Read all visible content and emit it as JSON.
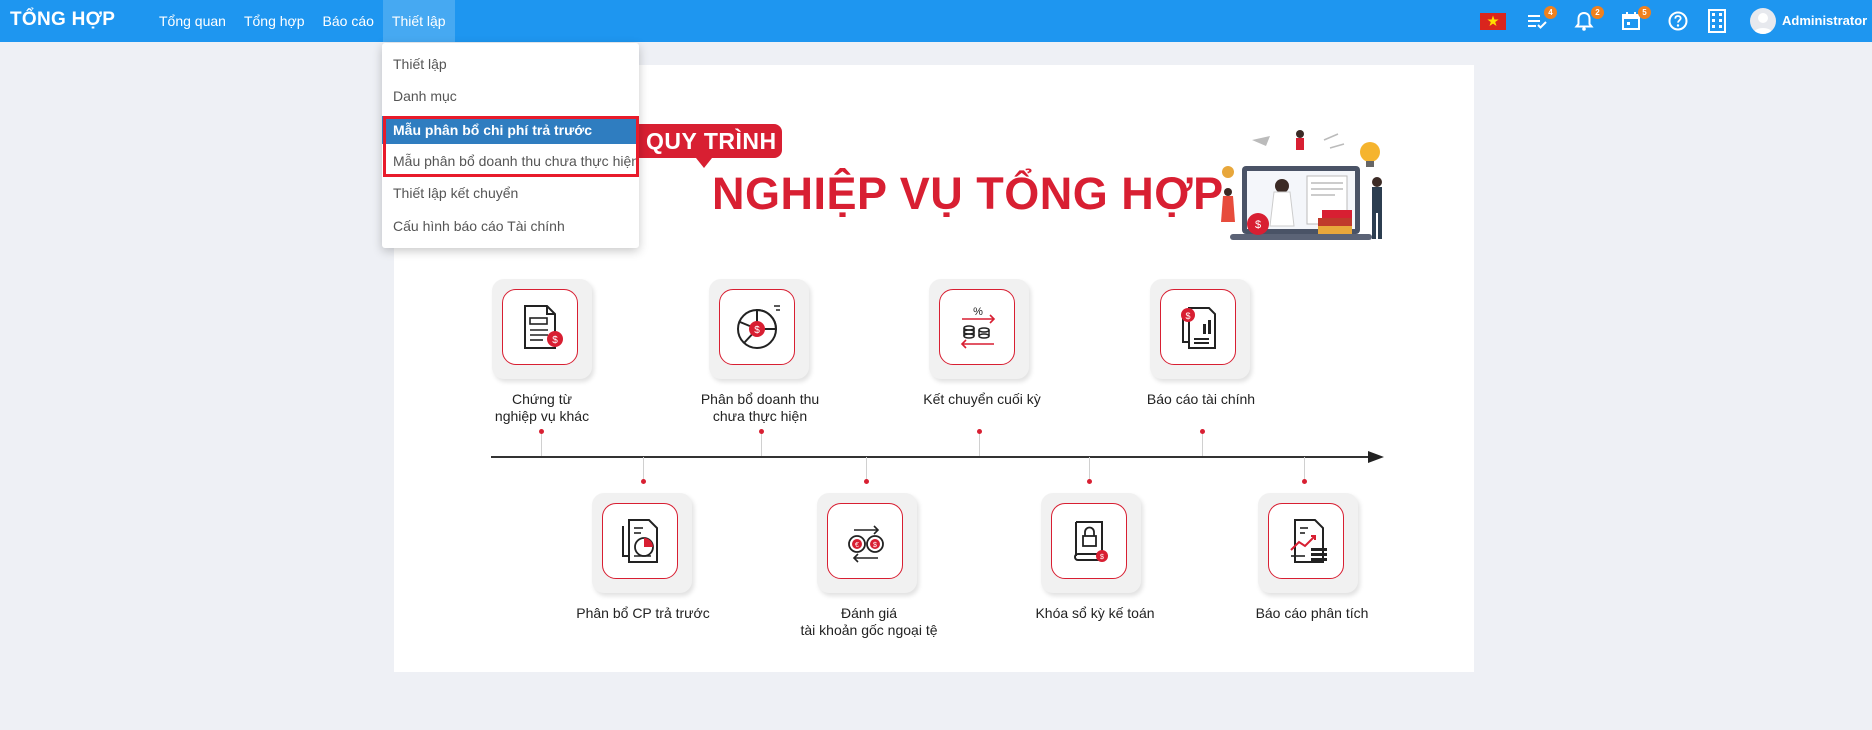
{
  "topbar": {
    "brand": "TỔNG HỢP",
    "nav": [
      "Tổng quan",
      "Tổng hợp",
      "Báo cáo",
      "Thiết lập"
    ],
    "active_nav": "Thiết lập",
    "badges": {
      "tasks": "4",
      "notifications": "2",
      "calendar": "5"
    },
    "user": "Administrator",
    "icons": [
      "vietnam-flag-icon",
      "task-list-icon",
      "bell-icon",
      "calendar-icon",
      "help-icon",
      "apps-grid-icon",
      "avatar"
    ]
  },
  "dropdown": {
    "items": [
      "Thiết lập",
      "Danh mục",
      "Mẫu phân bổ chi phí trả trước",
      "Mẫu phân bổ doanh thu chưa thực hiện",
      "Thiết lập kết chuyển",
      "Cấu hình báo cáo Tài chính"
    ],
    "selected": "Mẫu phân bổ chi phí trả trước"
  },
  "content": {
    "tag": "QUY TRÌNH",
    "title": "NGHIỆP VỤ TỔNG HỢP",
    "top_steps": [
      {
        "line1": "Chứng từ",
        "line2": "nghiệp vụ khác",
        "icon": "document-dollar-icon"
      },
      {
        "line1": "Phân bổ doanh thu",
        "line2": "chưa thực hiện",
        "icon": "pie-chart-dollar-icon"
      },
      {
        "line1": "Kết chuyển cuối kỳ",
        "line2": "",
        "icon": "transfer-coins-icon"
      },
      {
        "line1": "Báo cáo tài chính",
        "line2": "",
        "icon": "financial-report-icon"
      }
    ],
    "bottom_steps": [
      {
        "line1": "Phân bổ CP trả trước",
        "line2": "",
        "icon": "allocation-document-icon"
      },
      {
        "line1": "Đánh giá",
        "line2": "tài khoản gốc ngoại tệ",
        "icon": "currency-exchange-icon"
      },
      {
        "line1": "Khóa sổ kỳ kế toán",
        "line2": "",
        "icon": "lock-book-icon"
      },
      {
        "line1": "Báo cáo phân tích",
        "line2": "",
        "icon": "analysis-report-icon"
      }
    ]
  },
  "colors": {
    "topbar": "#1e96f0",
    "accent_red": "#d81f32",
    "menu_selected": "#2f7dc0",
    "badge": "#f0811e"
  }
}
